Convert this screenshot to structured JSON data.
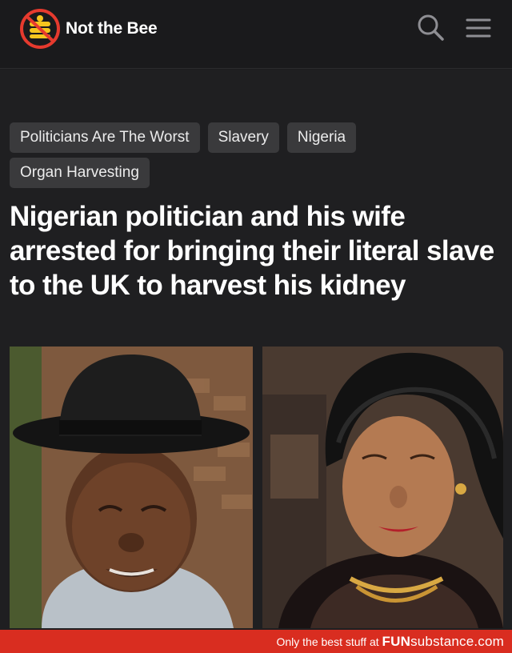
{
  "header": {
    "brand_name": "Not the Bee",
    "logo_icon": "crossed-bee-logo",
    "search_icon": "search-icon",
    "menu_icon": "hamburger-menu-icon",
    "colors": {
      "logo_red": "#e63a2e",
      "logo_yellow": "#f4c51e"
    }
  },
  "tags": [
    "Politicians Are The Worst",
    "Slavery",
    "Nigeria",
    "Organ Harvesting"
  ],
  "article": {
    "headline": "Nigerian politician and his wife arrested for bringing their literal slave to the UK to harvest his kidney"
  },
  "images": {
    "left": "man-in-black-bowler-hat",
    "right": "woman-in-black-head-wrap-with-necklace"
  },
  "footer": {
    "tagline": "Only the best stuff at ",
    "brand_bold": "FUN",
    "brand_rest": "substance.com",
    "color": "#d92d20"
  }
}
